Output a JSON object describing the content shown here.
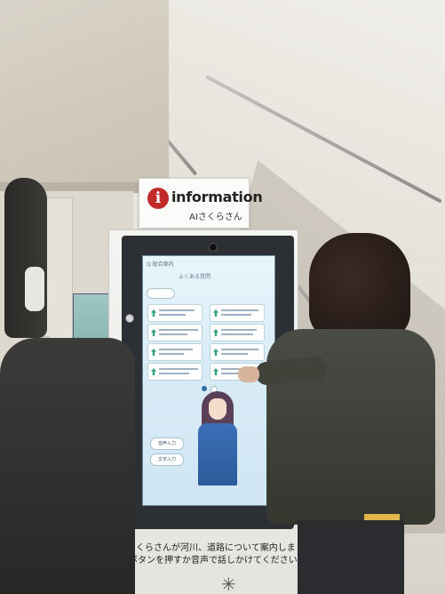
{
  "sign": {
    "i_mark": "i",
    "title": "information",
    "subtitle": "AIさくらさん"
  },
  "kiosk": {
    "screen_top_label": "Q 総合案内",
    "screen_heading": "よくある質問",
    "left_pill_1": "音声入力",
    "left_pill_2": "文字入力",
    "instruction_line1": "さくらさんが河川、道路について案内します",
    "instruction_line2": "ボタンを押すか音声で話しかけてください",
    "logo_glyph": "✳"
  }
}
